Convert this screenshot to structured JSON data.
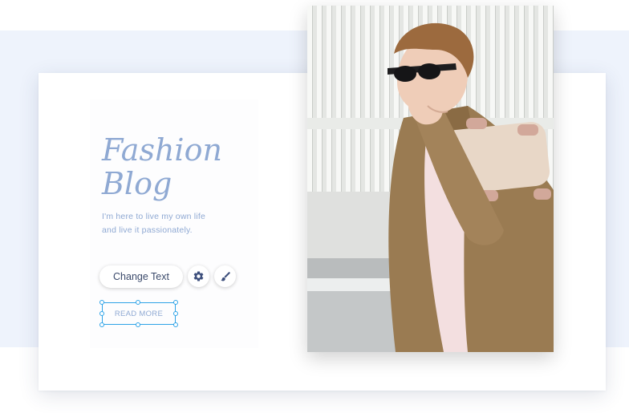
{
  "hero": {
    "title_line1": "Fashion",
    "title_line2": "Blog",
    "subtitle_line1": "I'm here to live my own life",
    "subtitle_line2": "and live it passionately."
  },
  "toolbar": {
    "change_text_label": "Change Text",
    "settings_icon": "gear-icon",
    "design_icon": "brush-icon"
  },
  "button": {
    "read_more_label": "READ MORE"
  },
  "colors": {
    "accent": "#8fa9d3",
    "selection": "#2ea3e7",
    "background_band": "#eef3fc"
  }
}
